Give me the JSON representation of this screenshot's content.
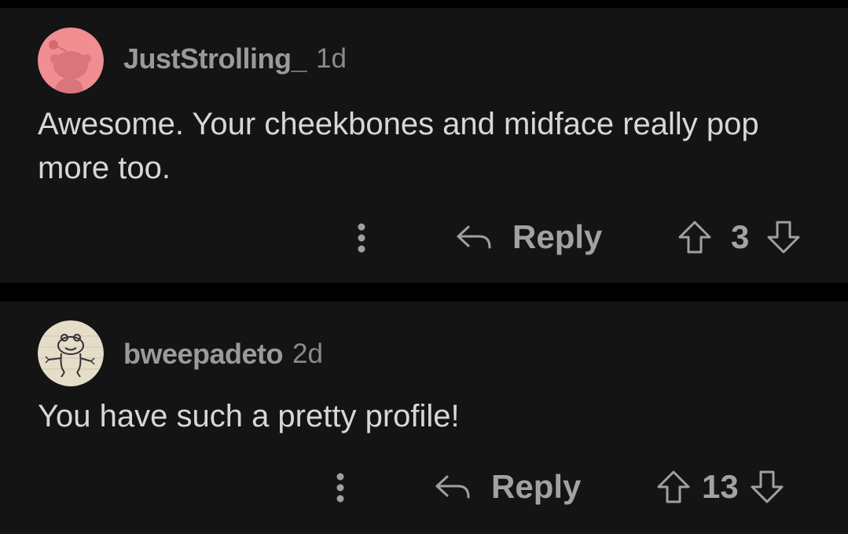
{
  "comments": [
    {
      "username": "JustStrolling_",
      "age": "1d",
      "body": "Awesome. Your cheekbones and midface really pop more too.",
      "reply_label": "Reply",
      "score": "3",
      "avatar_icon": "pink-snoo-avatar-icon",
      "avatar_color": "#f08e92"
    },
    {
      "username": "bweepadeto",
      "age": "2d",
      "body": "You have such a pretty profile!",
      "reply_label": "Reply",
      "score": "13",
      "avatar_icon": "frog-doodle-avatar-icon",
      "avatar_color": "#e6ddc8"
    }
  ],
  "icons": {
    "more": "vertical-ellipsis-icon",
    "reply": "reply-arrow-icon",
    "upvote": "upvote-arrow-icon",
    "downvote": "downvote-arrow-icon"
  }
}
